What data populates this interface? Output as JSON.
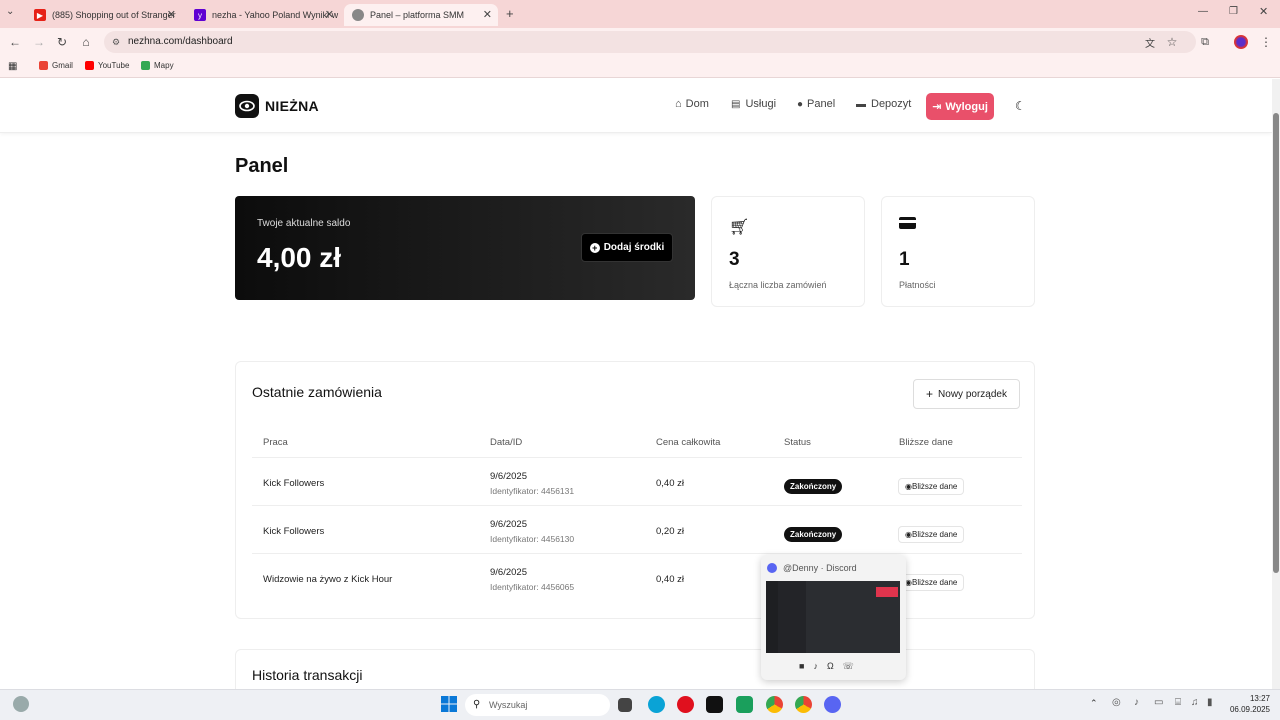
{
  "browser": {
    "tabs": [
      {
        "label": "(885) Shopping out of Stranger",
        "active": false,
        "fav_color": "#e62117"
      },
      {
        "label": "nezha - Yahoo Poland Wyniki w",
        "active": false,
        "fav_color": "#6001d2"
      },
      {
        "label": "Panel – platforma SMM",
        "active": true,
        "fav_color": "#666666"
      }
    ],
    "url": "nezhna.com/dashboard",
    "bookmarks": [
      {
        "label": "Gmail",
        "color": "#ea4335"
      },
      {
        "label": "YouTube",
        "color": "#ff0000"
      },
      {
        "label": "Mapy",
        "color": "#34a853"
      }
    ]
  },
  "site": {
    "brand": "NIEŻNA",
    "nav": [
      {
        "label": "Dom",
        "icon": "home-icon"
      },
      {
        "label": "Usługi",
        "icon": "store-icon"
      },
      {
        "label": "Panel",
        "icon": "user-icon"
      },
      {
        "label": "Depozyt",
        "icon": "wallet-icon"
      }
    ],
    "logout": "Wyloguj",
    "accent": "#e9506a"
  },
  "main": {
    "title": "Panel",
    "balance": {
      "label": "Twoje aktualne saldo",
      "amount": "4,00 zł",
      "add_button": "Dodaj środki"
    },
    "stats": [
      {
        "icon": "cart-icon",
        "value": "3",
        "label": "Łączna liczba zamówień"
      },
      {
        "icon": "credit-card-icon",
        "value": "1",
        "label": "Płatności"
      }
    ],
    "orders": {
      "title": "Ostatnie zamówienia",
      "new_button": "Nowy porządek",
      "headers": [
        "Praca",
        "Data/ID",
        "Cena całkowita",
        "Status",
        "Bliższe dane"
      ],
      "rows": [
        {
          "work": "Kick Followers",
          "date": "9/6/2025",
          "id": "Identyfikator: 4456131",
          "price": "0,40 zł",
          "status": "Zakończony",
          "details": "Bliższe dane"
        },
        {
          "work": "Kick Followers",
          "date": "9/6/2025",
          "id": "Identyfikator: 4456130",
          "price": "0,20 zł",
          "status": "Zakończony",
          "details": "Bliższe dane"
        },
        {
          "work": "Widzowie na żywo z Kick Hour",
          "date": "9/6/2025",
          "id": "Identyfikator: 4456065",
          "price": "0,40 zł",
          "status": "",
          "details": "Bliższe dane"
        }
      ]
    },
    "history_title": "Historia transakcji"
  },
  "discord_preview": {
    "title": "@Denny · Discord"
  },
  "taskbar": {
    "search_placeholder": "Wyszukaj",
    "time": "13:27",
    "date": "06.09.2025"
  }
}
